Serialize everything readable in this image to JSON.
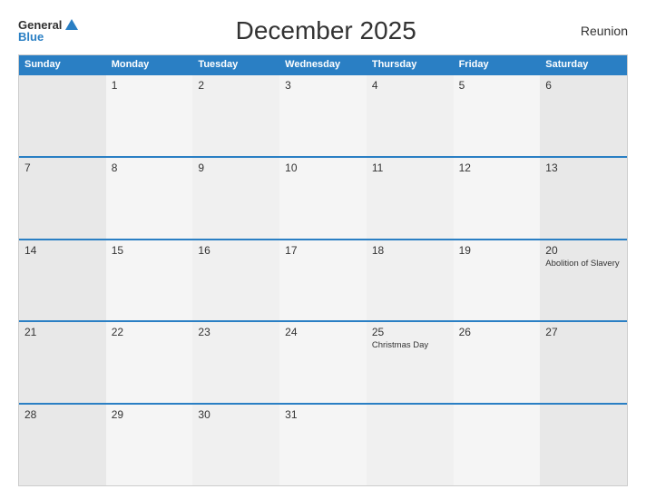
{
  "header": {
    "logo_general": "General",
    "logo_blue": "Blue",
    "title": "December 2025",
    "region": "Reunion"
  },
  "calendar": {
    "days_of_week": [
      "Sunday",
      "Monday",
      "Tuesday",
      "Wednesday",
      "Thursday",
      "Friday",
      "Saturday"
    ],
    "weeks": [
      [
        {
          "day": "",
          "event": ""
        },
        {
          "day": "1",
          "event": ""
        },
        {
          "day": "2",
          "event": ""
        },
        {
          "day": "3",
          "event": ""
        },
        {
          "day": "4",
          "event": ""
        },
        {
          "day": "5",
          "event": ""
        },
        {
          "day": "6",
          "event": ""
        }
      ],
      [
        {
          "day": "7",
          "event": ""
        },
        {
          "day": "8",
          "event": ""
        },
        {
          "day": "9",
          "event": ""
        },
        {
          "day": "10",
          "event": ""
        },
        {
          "day": "11",
          "event": ""
        },
        {
          "day": "12",
          "event": ""
        },
        {
          "day": "13",
          "event": ""
        }
      ],
      [
        {
          "day": "14",
          "event": ""
        },
        {
          "day": "15",
          "event": ""
        },
        {
          "day": "16",
          "event": ""
        },
        {
          "day": "17",
          "event": ""
        },
        {
          "day": "18",
          "event": ""
        },
        {
          "day": "19",
          "event": ""
        },
        {
          "day": "20",
          "event": "Abolition of Slavery"
        }
      ],
      [
        {
          "day": "21",
          "event": ""
        },
        {
          "day": "22",
          "event": ""
        },
        {
          "day": "23",
          "event": ""
        },
        {
          "day": "24",
          "event": ""
        },
        {
          "day": "25",
          "event": "Christmas Day"
        },
        {
          "day": "26",
          "event": ""
        },
        {
          "day": "27",
          "event": ""
        }
      ],
      [
        {
          "day": "28",
          "event": ""
        },
        {
          "day": "29",
          "event": ""
        },
        {
          "day": "30",
          "event": ""
        },
        {
          "day": "31",
          "event": ""
        },
        {
          "day": "",
          "event": ""
        },
        {
          "day": "",
          "event": ""
        },
        {
          "day": "",
          "event": ""
        }
      ]
    ]
  }
}
